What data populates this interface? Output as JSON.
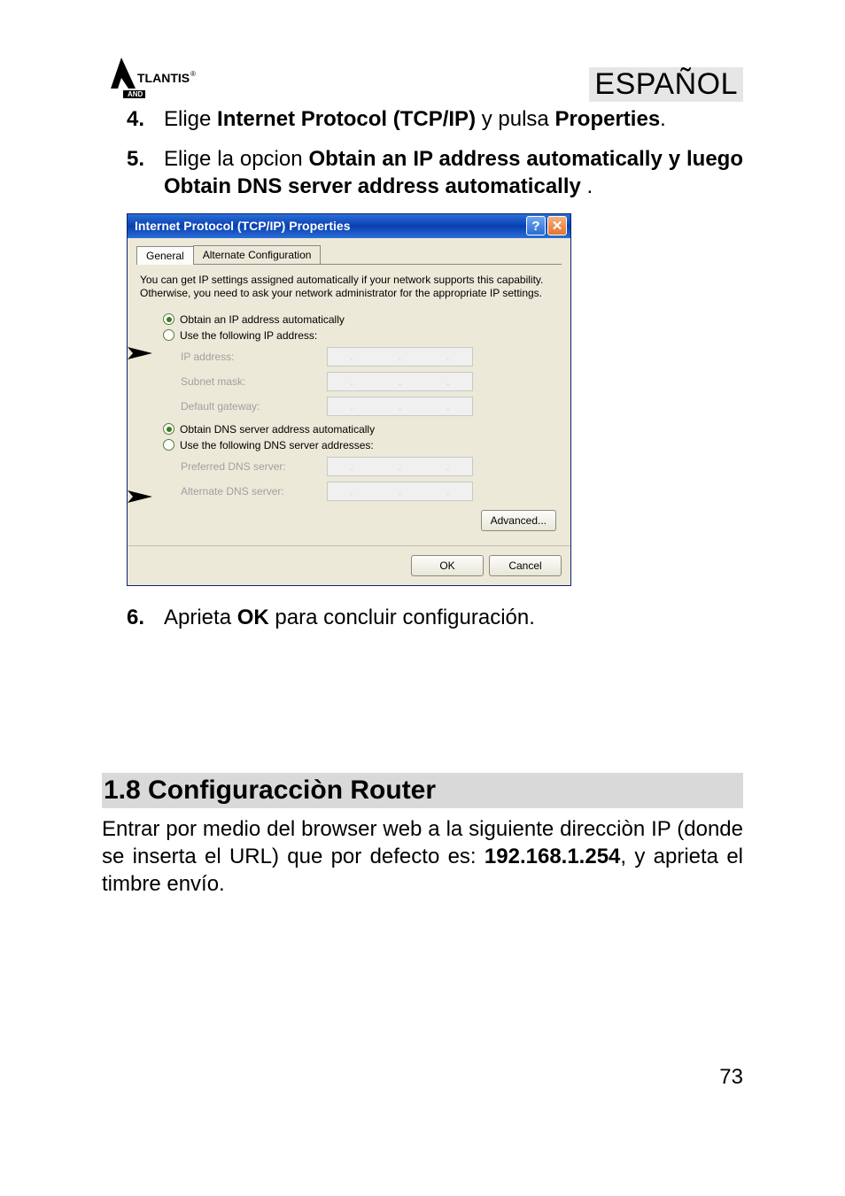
{
  "header": {
    "logo_text": "ATLANTIS",
    "logo_sub": "AND",
    "language": "ESPAÑOL"
  },
  "steps": {
    "s4": {
      "num": "4.",
      "pre": "Elige ",
      "bold1": "Internet Protocol (TCP/IP)",
      "mid": " y pulsa  ",
      "bold2": "Properties",
      "post": "."
    },
    "s5": {
      "num": "5.",
      "pre": "Elige la opcion ",
      "bold1": "Obtain an IP address automatically y luego Obtain DNS server address automatically",
      "post": " ."
    },
    "s6": {
      "num": "6.",
      "pre": "Aprieta  ",
      "bold1": "OK",
      "post": " para concluir configuración."
    }
  },
  "dialog": {
    "title": "Internet Protocol (TCP/IP) Properties",
    "help_btn": "?",
    "close_btn": "✕",
    "tabs": {
      "general": "General",
      "alt": "Alternate Configuration"
    },
    "desc": "You can get IP settings assigned automatically if your network supports this capability. Otherwise, you need to ask your network administrator for the appropriate IP settings.",
    "radio_obtain_ip": "Obtain an IP address automatically",
    "radio_use_ip": "Use the following IP address:",
    "ip_address": "IP address:",
    "subnet": "Subnet mask:",
    "gateway": "Default gateway:",
    "radio_obtain_dns": "Obtain DNS server address automatically",
    "radio_use_dns": "Use the following DNS server addresses:",
    "pref_dns": "Preferred DNS server:",
    "alt_dns": "Alternate DNS server:",
    "advanced": "Advanced...",
    "ok": "OK",
    "cancel": "Cancel"
  },
  "section": {
    "heading": "1.8 Configuracciòn Router",
    "para_pre": "Entrar por medio del browser web a la siguiente direcciòn IP (donde se inserta el URL) que por defecto es: ",
    "ip": "192.168.1.254",
    "para_post": ", y aprieta el timbre  envío."
  },
  "page_number": "73"
}
